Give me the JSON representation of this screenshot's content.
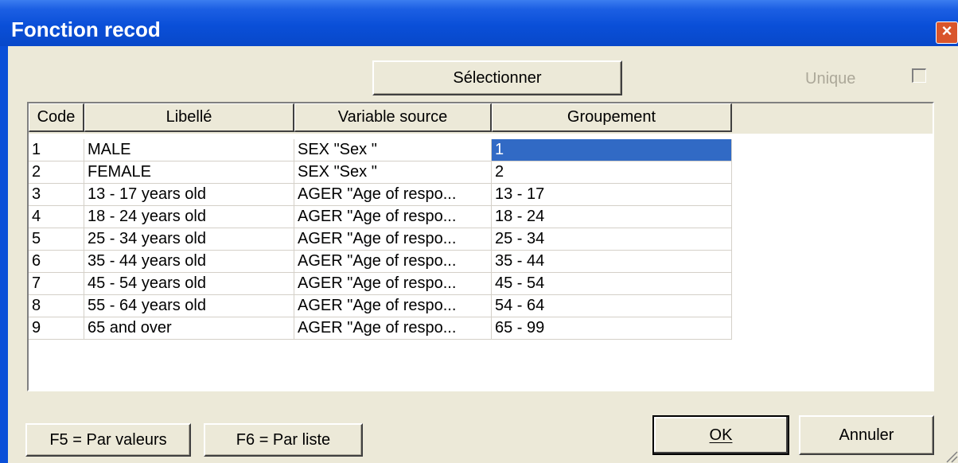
{
  "window": {
    "title": "Fonction recod",
    "close_icon": "close-icon"
  },
  "toolbar": {
    "select_label": "Sélectionner",
    "unique_label": "Unique",
    "unique_checked": false
  },
  "table": {
    "headers": [
      "Code",
      "Libellé",
      "Variable source",
      "Groupement"
    ],
    "rows": [
      [
        "1",
        "MALE",
        "SEX \"Sex  \"",
        "1"
      ],
      [
        "2",
        "FEMALE",
        "SEX \"Sex  \"",
        "2"
      ],
      [
        "3",
        "13 - 17 years old",
        "AGER \"Age of respo...",
        "13 - 17"
      ],
      [
        "4",
        "18 - 24 years old",
        "AGER \"Age of respo...",
        "18 - 24"
      ],
      [
        "5",
        "25 - 34 years old",
        "AGER \"Age of respo...",
        "25 - 34"
      ],
      [
        "6",
        "35 - 44 years old",
        "AGER \"Age of respo...",
        "35 - 44"
      ],
      [
        "7",
        "45 - 54 years old",
        "AGER \"Age of respo...",
        "45 - 54"
      ],
      [
        "8",
        "55 - 64 years old",
        "AGER \"Age of respo...",
        "54 - 64"
      ],
      [
        "9",
        "65 and over",
        "AGER \"Age of respo...",
        "65 - 99"
      ]
    ],
    "selected_cell": "Groupement row 1"
  },
  "footer": {
    "f5_label": "F5 = Par valeurs",
    "f6_label": "F6 = Par liste",
    "ok_label": "OK",
    "cancel_label": "Annuler"
  },
  "colors": {
    "titlebar": "#0a4fd8",
    "dialog_bg": "#ece9d8",
    "selection": "#316ac5",
    "close_button": "#d9552b"
  }
}
